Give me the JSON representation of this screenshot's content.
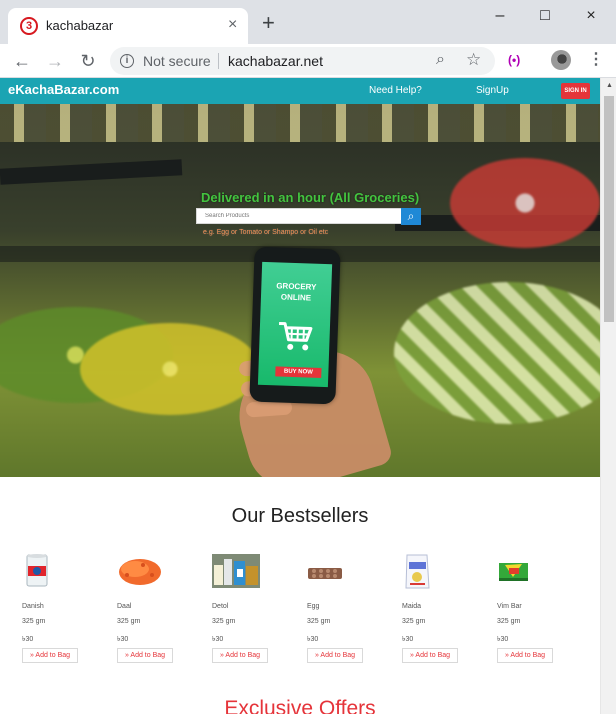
{
  "browser": {
    "tab": {
      "favicon": "3",
      "title": "kachabazar",
      "close": "×",
      "new_tab": "+"
    },
    "window_controls": {
      "minimize": "–",
      "maximize": "□",
      "close": "×"
    },
    "toolbar": {
      "back": "←",
      "forward": "→",
      "reload": "↻",
      "security_icon": "i",
      "security_label": "Not secure",
      "url": "kachabazar.net",
      "zoom": "⌕",
      "bookmark": "☆",
      "cast": "(•)",
      "menu": "⋮"
    }
  },
  "site": {
    "brand": "eKachaBazar.com",
    "nav": {
      "help": "Need Help?",
      "signup": "SignUp",
      "signin": "SIGN IN"
    },
    "hero": {
      "title": "Delivered in an hour (All Groceries)",
      "search_placeholder": "Search Products",
      "search_icon": "⌕",
      "hint": "e.g. Egg or Tomato or Shampo or Oil etc",
      "phone_title": "GROCERY ONLINE",
      "phone_button": "BUY NOW"
    },
    "bestsellers": {
      "heading": "Our Bestsellers",
      "products": [
        {
          "name": "Danish",
          "qty": "325 gm",
          "price": "৳30",
          "button": "» Add to Bag",
          "icon": "milk-can-icon"
        },
        {
          "name": "Daal",
          "qty": "325 gm",
          "price": "৳30",
          "button": "» Add to Bag",
          "icon": "lentils-icon"
        },
        {
          "name": "Detol",
          "qty": "325 gm",
          "price": "৳30",
          "button": "» Add to Bag",
          "icon": "detol-products-icon"
        },
        {
          "name": "Egg",
          "qty": "325 gm",
          "price": "৳30",
          "button": "» Add to Bag",
          "icon": "egg-tray-icon"
        },
        {
          "name": "Maida",
          "qty": "325 gm",
          "price": "৳30",
          "button": "» Add to Bag",
          "icon": "flour-packet-icon"
        },
        {
          "name": "Vim Bar",
          "qty": "325 gm",
          "price": "৳30",
          "button": "» Add to Bag",
          "icon": "vim-bar-icon"
        }
      ]
    },
    "exclusive": {
      "heading": "Exclusive Offers"
    }
  },
  "colors": {
    "nav": "#1ba4b3",
    "signin": "#e5343a",
    "hero_title": "#43c43f",
    "search_button": "#1f89d6",
    "phone_screen": "#18b96b",
    "exclusive": "#e5343a"
  }
}
